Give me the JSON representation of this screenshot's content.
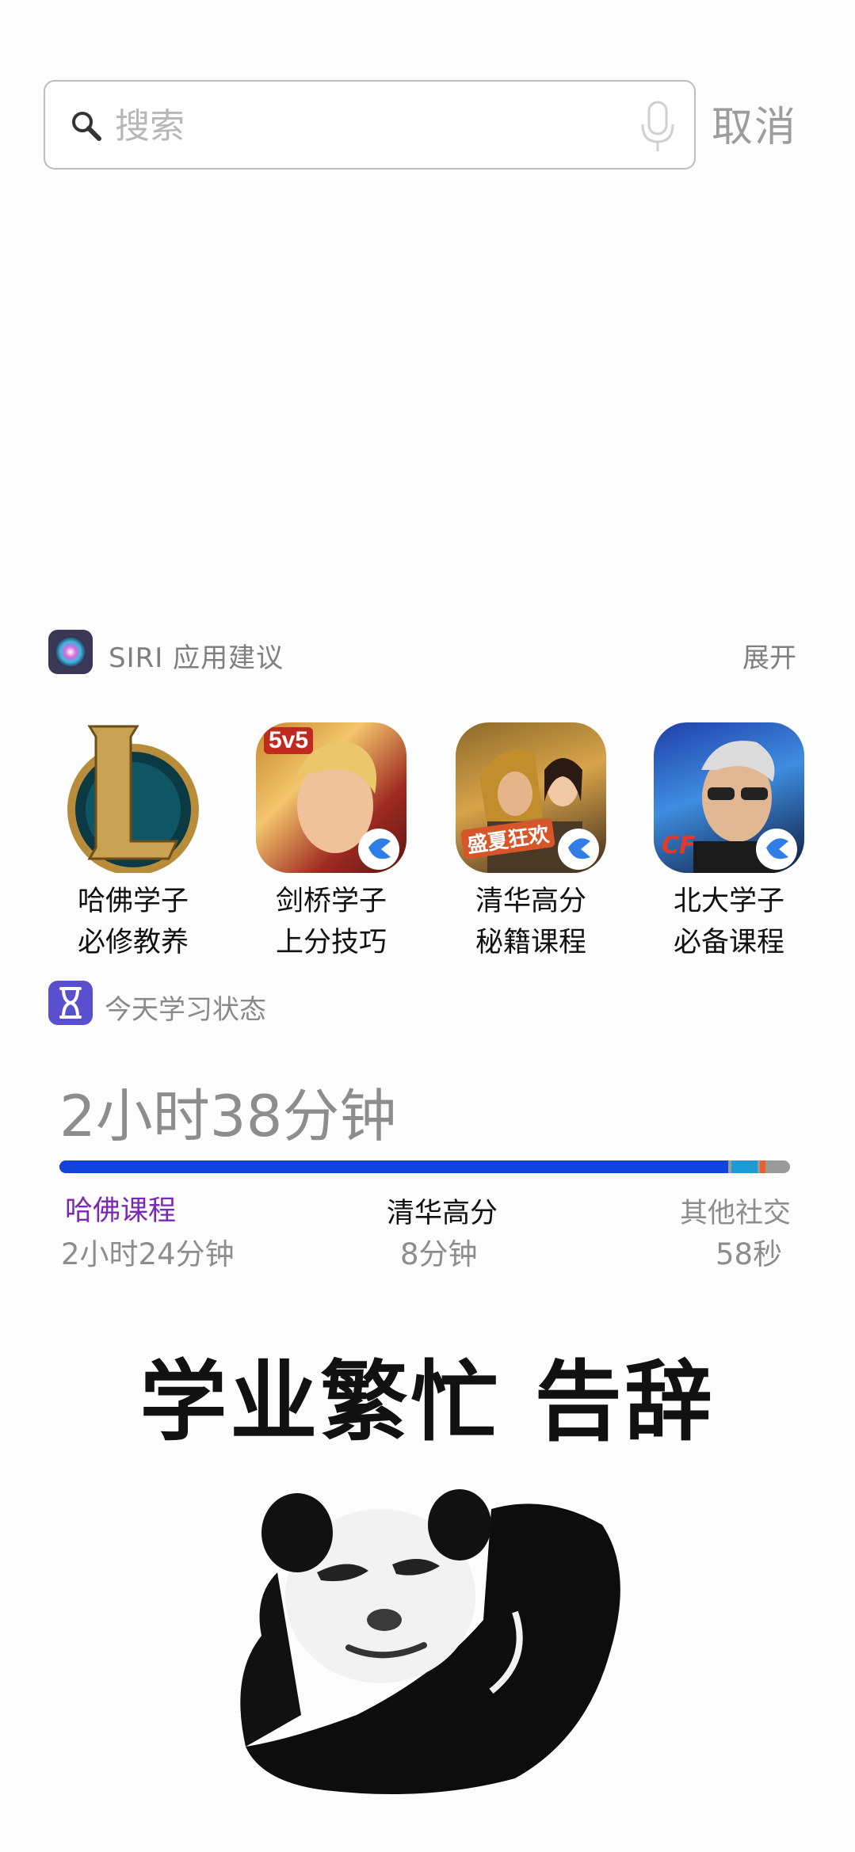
{
  "search": {
    "placeholder": "搜索",
    "value": "",
    "cancel_label": "取消"
  },
  "siri": {
    "title": "SIRI 应用建议",
    "expand_label": "展开",
    "apps": [
      {
        "line1": "哈佛学子",
        "line2": "必修教养"
      },
      {
        "line1": "剑桥学子",
        "line2": "上分技巧",
        "icon_text": "5v5"
      },
      {
        "line1": "清华高分",
        "line2": "秘籍课程",
        "icon_text": "盛夏狂欢"
      },
      {
        "line1": "北大学子",
        "line2": "必备课程",
        "icon_text": "CF"
      }
    ]
  },
  "screen_time": {
    "title": "今天学习状态",
    "total": "2小时38分钟",
    "usage_fractions": {
      "primary": 0.915,
      "secondary": 0.036,
      "other": 0.008
    },
    "categories": [
      {
        "name": "哈佛课程",
        "time": "2小时24分钟",
        "color": "#7a28b8"
      },
      {
        "name": "清华高分",
        "time": "8分钟",
        "color": "#111111"
      },
      {
        "name": "其他社交",
        "time": "58秒",
        "color": "#8d8d8d"
      }
    ],
    "bar_colors": {
      "primary": "#1443d9",
      "secondary": "#1e9ad6",
      "other": "#e8602c",
      "rest": "#9a9a9a"
    }
  },
  "slogan": "学业繁忙 告辞",
  "icons": {
    "search": "search-icon",
    "mic": "microphone-icon",
    "siri": "siri-icon",
    "screentime": "hourglass-icon"
  }
}
